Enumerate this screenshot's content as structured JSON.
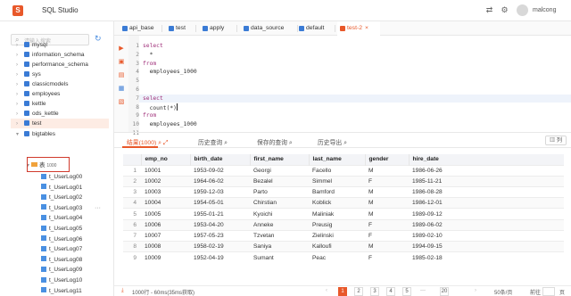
{
  "app": {
    "title": "SQL Studio",
    "logo": "S",
    "user": "malcong"
  },
  "sidebar": {
    "search_placeholder": "请输入搜索",
    "databases": [
      "mysql",
      "information_schema",
      "performance_schema",
      "sys",
      "classicmodels",
      "employees",
      "kettle",
      "ods_kettle",
      "test",
      "bigtables"
    ],
    "folder": {
      "label": "表",
      "count": "1000"
    },
    "tables": [
      "t_UserLog00",
      "t_UserLog01",
      "t_UserLog02",
      "t_UserLog03",
      "t_UserLog04",
      "t_UserLog05",
      "t_UserLog06",
      "t_UserLog07",
      "t_UserLog08",
      "t_UserLog09",
      "t_UserLog10",
      "t_UserLog11"
    ],
    "more": "···"
  },
  "tabs": [
    {
      "label": "api_base"
    },
    {
      "label": "test"
    },
    {
      "label": "apply"
    },
    {
      "label": "data_source"
    },
    {
      "label": "default"
    },
    {
      "label": "test-2",
      "close": "×"
    }
  ],
  "editor": {
    "line_numbers": [
      "1",
      "2",
      "3",
      "4",
      "5",
      "6",
      "7",
      "8",
      "9",
      "10",
      "11"
    ],
    "lines": [
      "select",
      "  *",
      "from",
      "  employees_1000",
      "",
      "",
      "select",
      "  count(*)",
      "from",
      "  employees_1000",
      ""
    ]
  },
  "results": {
    "tabs": [
      "结果(1000)",
      "历史查询",
      "保存的查询",
      "历史导出"
    ],
    "list_button": "列",
    "columns": [
      "emp_no",
      "birth_date",
      "first_name",
      "last_name",
      "gender",
      "hire_date"
    ],
    "rows": [
      [
        "1",
        "10001",
        "1953-09-02",
        "Georgi",
        "Facello",
        "M",
        "1986-06-26"
      ],
      [
        "2",
        "10002",
        "1964-06-02",
        "Bezalel",
        "Simmel",
        "F",
        "1985-11-21"
      ],
      [
        "3",
        "10003",
        "1959-12-03",
        "Parto",
        "Bamford",
        "M",
        "1986-08-28"
      ],
      [
        "4",
        "10004",
        "1954-05-01",
        "Chirstian",
        "Koblick",
        "M",
        "1986-12-01"
      ],
      [
        "5",
        "10005",
        "1955-01-21",
        "Kyoichi",
        "Maliniak",
        "M",
        "1989-09-12"
      ],
      [
        "6",
        "10006",
        "1953-04-20",
        "Anneke",
        "Preusig",
        "F",
        "1989-06-02"
      ],
      [
        "7",
        "10007",
        "1957-05-23",
        "Tzvetan",
        "Zielinski",
        "F",
        "1989-02-10"
      ],
      [
        "8",
        "10008",
        "1958-02-19",
        "Saniya",
        "Kalloufi",
        "M",
        "1994-09-15"
      ],
      [
        "9",
        "10009",
        "1952-04-19",
        "Sumant",
        "Peac",
        "F",
        "1985-02-18"
      ]
    ]
  },
  "status": {
    "summary": "1000行 - 60ms(35ms获取)",
    "pages": [
      "1",
      "2",
      "3",
      "4",
      "5",
      "···",
      "20"
    ],
    "per_page": "50条/页",
    "goto": "前往",
    "goto_unit": "页"
  },
  "colors": {
    "accent": "#e8582a",
    "db_icon": "#3a7bd5",
    "highlight_border": "#d03a2c"
  }
}
